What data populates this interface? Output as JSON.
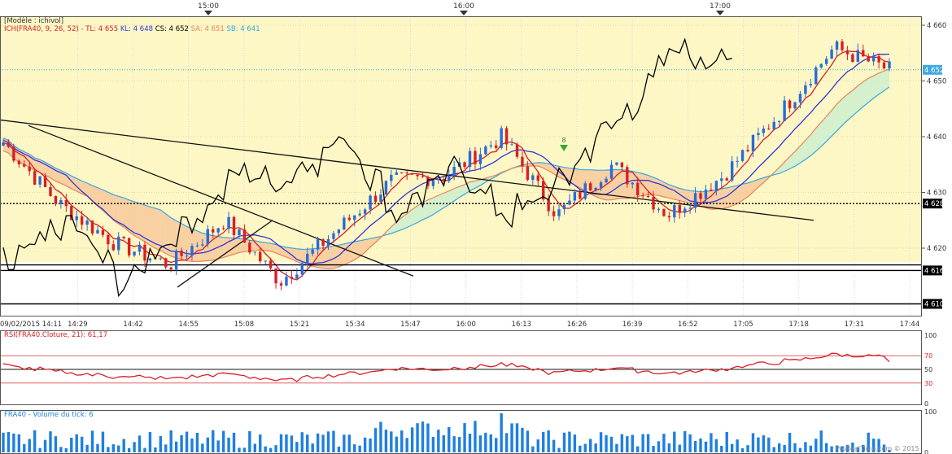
{
  "legend": {
    "model": "[Modèle : ichivol]",
    "ichimoku_title": "ICH(FRA40, 9, 26, 52) -",
    "tl": "TL: 4 655",
    "kl": "KL: 4 648",
    "cs": "CS: 4 652",
    "sa": "SA: 4 651",
    "sb": "SB: 4 641",
    "rsi": "RSI(FRA40.Cloture, 21): 61,17",
    "volume": "FRA40 - Volume du tick: 6"
  },
  "watermark": "ProRealTime.com © 2015",
  "top_time_labels": [
    "15:00",
    "16:00",
    "17:00"
  ],
  "x_tick_labels": [
    "09/02/2015 14:11",
    "14:29",
    "14:42",
    "14:55",
    "15:08",
    "15:21",
    "15:34",
    "15:47",
    "16:00",
    "16:13",
    "16:26",
    "16:39",
    "16:52",
    "17:05",
    "17:18",
    "17:31",
    "17:44"
  ],
  "price_axis_labels": [
    "4 660",
    "4 650",
    "4 640",
    "4 630",
    "4 620"
  ],
  "price_badges": [
    {
      "text": "4 652",
      "bg": "#3fa9e0",
      "fg": "#ffffff"
    },
    {
      "text": "4 628",
      "bg": "#000000",
      "fg": "#ffffff"
    },
    {
      "text": "4 616",
      "bg": "#000000",
      "fg": "#ffffff"
    },
    {
      "text": "4 610",
      "bg": "#000000",
      "fg": "#ffffff"
    }
  ],
  "rsi_axis_labels": [
    "100",
    "70",
    "50",
    "30",
    "0"
  ],
  "volume_axis_labels": [
    "100",
    "0"
  ],
  "signal_label": "8",
  "colors": {
    "bull": "#2a6bd6",
    "bear": "#d81f26",
    "tenkan": "#d81f26",
    "kijun": "#2f35d8",
    "ssa": "#e8845a",
    "ssb": "#3aa6e0",
    "chikou": "#000000",
    "cloud_bull": "#cdeecd",
    "cloud_bear": "#f7c99a",
    "volume": "#1f7fe0",
    "rsi": "#d81f26",
    "plot_bg": "#fdf7c5"
  },
  "chart_data": {
    "type": "candlestick",
    "symbol": "FRA40",
    "date": "09/02/2015",
    "ylim": [
      4608,
      4662
    ],
    "x_start": "14:11",
    "x_end": "17:44",
    "candles_sample": [
      {
        "t": "14:11",
        "o": 4637,
        "h": 4640,
        "l": 4636,
        "c": 4639
      },
      {
        "t": "14:29",
        "o": 4630,
        "h": 4632,
        "l": 4628,
        "c": 4628
      },
      {
        "t": "14:42",
        "o": 4625,
        "h": 4626,
        "l": 4620,
        "c": 4621
      },
      {
        "t": "14:55",
        "o": 4614,
        "h": 4618,
        "l": 4613,
        "c": 4617
      },
      {
        "t": "15:08",
        "o": 4622,
        "h": 4626,
        "l": 4621,
        "c": 4625
      },
      {
        "t": "15:21",
        "o": 4616,
        "h": 4618,
        "l": 4613,
        "c": 4614
      },
      {
        "t": "15:34",
        "o": 4620,
        "h": 4625,
        "l": 4619,
        "c": 4623
      },
      {
        "t": "15:47",
        "o": 4628,
        "h": 4633,
        "l": 4627,
        "c": 4632
      },
      {
        "t": "16:00",
        "o": 4634,
        "h": 4638,
        "l": 4632,
        "c": 4633
      },
      {
        "t": "16:13",
        "o": 4634,
        "h": 4642,
        "l": 4633,
        "c": 4640
      },
      {
        "t": "16:26",
        "o": 4628,
        "h": 4630,
        "l": 4625,
        "c": 4626
      },
      {
        "t": "16:39",
        "o": 4630,
        "h": 4636,
        "l": 4629,
        "c": 4635
      },
      {
        "t": "16:52",
        "o": 4625,
        "h": 4628,
        "l": 4624,
        "c": 4626
      },
      {
        "t": "17:05",
        "o": 4628,
        "h": 4634,
        "l": 4627,
        "c": 4633
      },
      {
        "t": "17:18",
        "o": 4638,
        "h": 4645,
        "l": 4637,
        "c": 4644
      },
      {
        "t": "17:31",
        "o": 4653,
        "h": 4659,
        "l": 4652,
        "c": 4656
      },
      {
        "t": "17:44",
        "o": 4652,
        "h": 4654,
        "l": 4650,
        "c": 4652
      }
    ],
    "horizontal_levels": [
      4628,
      4617,
      4616,
      4610
    ],
    "last_price": 4652,
    "rsi": {
      "period": 21,
      "last": 61.17,
      "levels": [
        70,
        50,
        30
      ],
      "ylim": [
        0,
        100
      ]
    },
    "volume": {
      "last": 6,
      "ylim": [
        0,
        100
      ]
    }
  }
}
